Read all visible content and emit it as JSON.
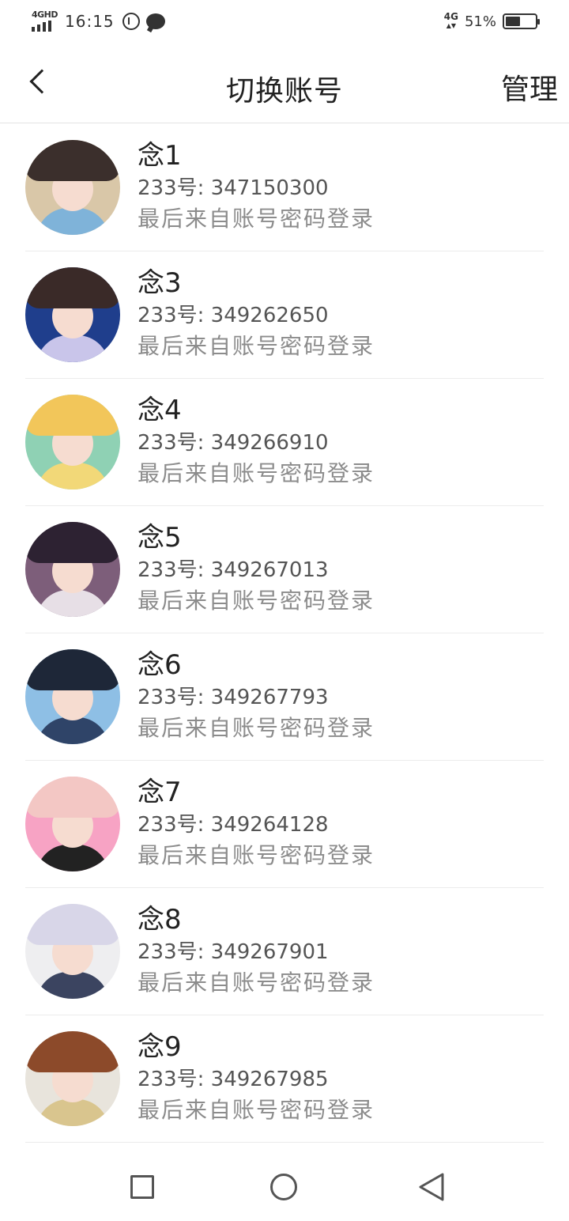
{
  "status_bar": {
    "network_left": "4GHD",
    "time": "16:15",
    "network_right": "4G",
    "battery_percent": "51%",
    "battery_level": 0.51
  },
  "header": {
    "title": "切换账号",
    "manage_label": "管理"
  },
  "accounts": [
    {
      "name": "念1",
      "id_text": "233号: 347150300",
      "last_login": "最后来自账号密码登录",
      "hair": "#3b2f2c",
      "bg": "#d9c7a8",
      "shirt": "#7fb3d9"
    },
    {
      "name": "念3",
      "id_text": "233号: 349262650",
      "last_login": "最后来自账号密码登录",
      "hair": "#3a2a28",
      "bg": "#1f3e8c",
      "shirt": "#c9c5ea"
    },
    {
      "name": "念4",
      "id_text": "233号: 349266910",
      "last_login": "最后来自账号密码登录",
      "hair": "#f2c65a",
      "bg": "#8fd1b4",
      "shirt": "#f2d878"
    },
    {
      "name": "念5",
      "id_text": "233号: 349267013",
      "last_login": "最后来自账号密码登录",
      "hair": "#2d2232",
      "bg": "#7d5e7a",
      "shirt": "#e7dfe6"
    },
    {
      "name": "念6",
      "id_text": "233号: 349267793",
      "last_login": "最后来自账号密码登录",
      "hair": "#1e2738",
      "bg": "#8ebfe5",
      "shirt": "#2f4468"
    },
    {
      "name": "念7",
      "id_text": "233号: 349264128",
      "last_login": "最后来自账号密码登录",
      "hair": "#f3c7c4",
      "bg": "#f7a3c4",
      "shirt": "#222222"
    },
    {
      "name": "念8",
      "id_text": "233号: 349267901",
      "last_login": "最后来自账号密码登录",
      "hair": "#d8d6e8",
      "bg": "#eeeef0",
      "shirt": "#3b4460"
    },
    {
      "name": "念9",
      "id_text": "233号: 349267985",
      "last_login": "最后来自账号密码登录",
      "hair": "#8c4a2a",
      "bg": "#e8e4dc",
      "shirt": "#d9c58e"
    }
  ],
  "nav": {
    "recent_icon": "square-icon",
    "home_icon": "circle-icon",
    "back_icon": "triangle-back-icon"
  }
}
